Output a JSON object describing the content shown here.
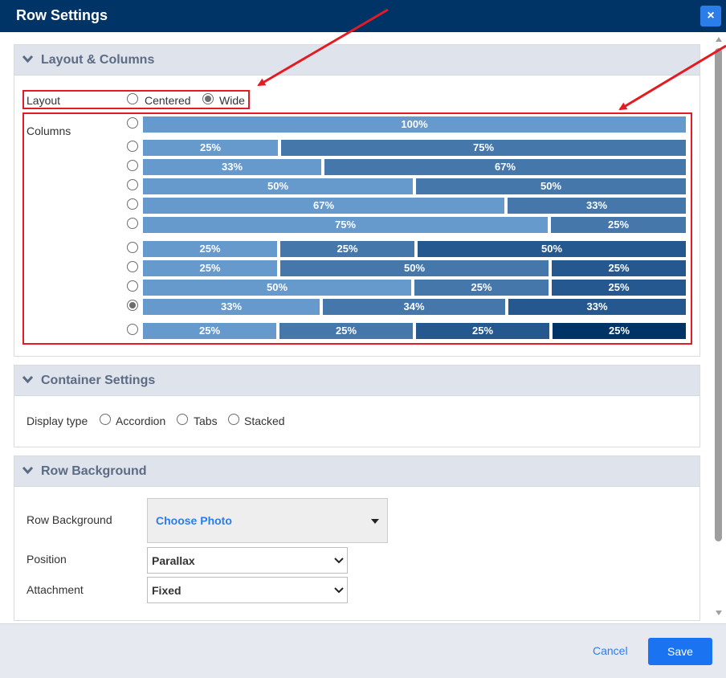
{
  "dialog": {
    "title": "Row Settings",
    "close_symbol": "×"
  },
  "sections": {
    "layout": {
      "title": "Layout & Columns"
    },
    "container": {
      "title": "Container Settings"
    },
    "background": {
      "title": "Row Background"
    }
  },
  "layout": {
    "label": "Layout",
    "options": [
      "Centered",
      "Wide"
    ],
    "selected": "Wide"
  },
  "columns": {
    "label": "Columns",
    "selected_index": 9,
    "rows": [
      [
        "100%"
      ],
      [
        "25%",
        "75%"
      ],
      [
        "33%",
        "67%"
      ],
      [
        "50%",
        "50%"
      ],
      [
        "67%",
        "33%"
      ],
      [
        "75%",
        "25%"
      ],
      [
        "25%",
        "25%",
        "50%"
      ],
      [
        "25%",
        "50%",
        "25%"
      ],
      [
        "50%",
        "25%",
        "25%"
      ],
      [
        "33%",
        "34%",
        "33%"
      ],
      [
        "25%",
        "25%",
        "25%",
        "25%"
      ]
    ],
    "colors": [
      "#6699cc",
      "#4577ab",
      "#25588f",
      "#003366"
    ]
  },
  "container": {
    "display_label": "Display type",
    "options": [
      "Accordion",
      "Tabs",
      "Stacked"
    ]
  },
  "background": {
    "row_background_label": "Row Background",
    "choose_photo": "Choose Photo",
    "position_label": "Position",
    "position_value": "Parallax",
    "attachment_label": "Attachment",
    "attachment_value": "Fixed"
  },
  "footer": {
    "cancel": "Cancel",
    "save": "Save"
  },
  "annotation_color": "#e31b23"
}
